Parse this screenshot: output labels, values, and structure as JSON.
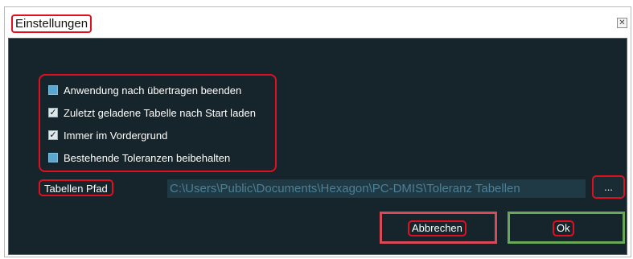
{
  "window": {
    "title": "Einstellungen",
    "close_icon": "close-icon"
  },
  "options": [
    {
      "label": "Anwendung nach übertragen beenden",
      "checked": false
    },
    {
      "label": "Zuletzt geladene Tabelle nach Start laden",
      "checked": true
    },
    {
      "label": "Immer im Vordergrund",
      "checked": true
    },
    {
      "label": "Bestehende Toleranzen beibehalten",
      "checked": false
    }
  ],
  "path": {
    "label": "Tabellen Pfad",
    "value": "C:\\Users\\Public\\Documents\\Hexagon\\PC-DMIS\\Toleranz Tabellen",
    "browse_label": "..."
  },
  "buttons": {
    "cancel_label": "Abbrechen",
    "ok_label": "Ok"
  },
  "colors": {
    "background": "#16252b",
    "highlight": "#e01020",
    "cancel_frame": "#d94a58",
    "ok_frame": "#69a85a"
  }
}
